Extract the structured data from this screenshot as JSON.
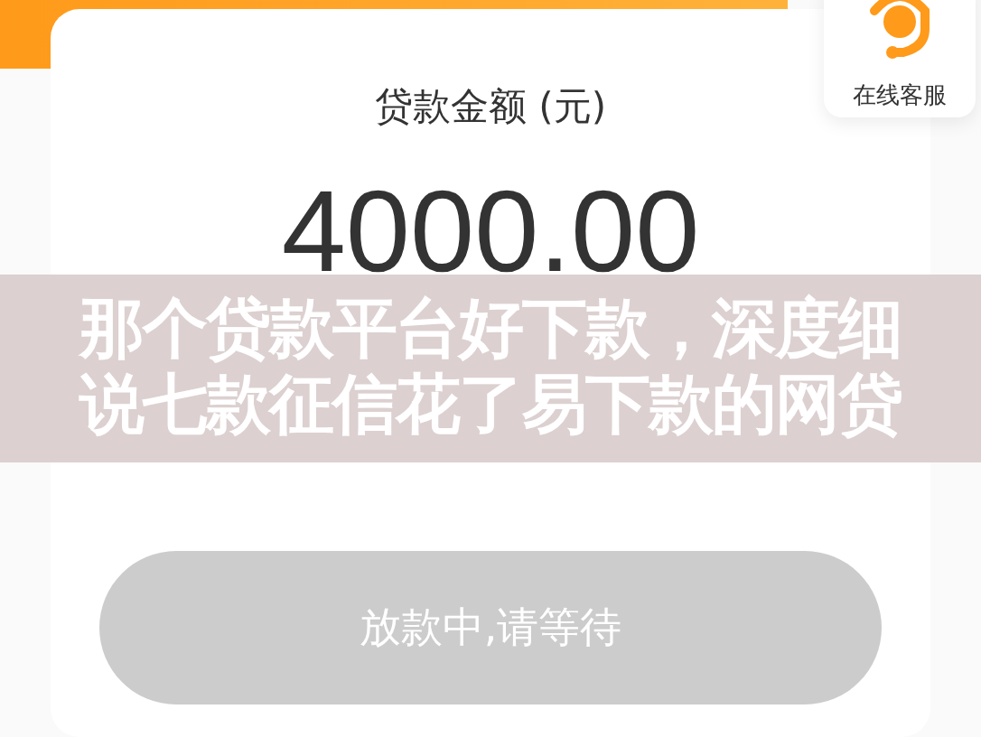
{
  "loan": {
    "label": "贷款金额 (元)",
    "amount": "4000.00"
  },
  "status_button": {
    "label": "放款中,请等待",
    "disabled": true
  },
  "service": {
    "label": "在线客服"
  },
  "headline": {
    "lines": [
      "那个贷款平台好下款，深度细",
      "说七款征信花了易下款的网贷"
    ]
  }
}
